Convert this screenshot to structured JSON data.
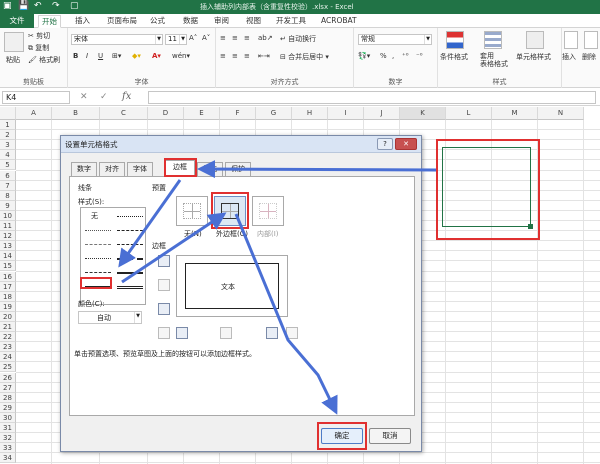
{
  "window": {
    "title": "插入辅助列内部表（含重复性校验）.xlsx - Excel"
  },
  "tabs": [
    "文件",
    "开始",
    "插入",
    "页面布局",
    "公式",
    "数据",
    "审阅",
    "视图",
    "开发工具",
    "ACROBAT"
  ],
  "ribbon": {
    "clipboard": {
      "paste": "粘贴",
      "cut": "剪切",
      "copy": "复制",
      "format_painter": "格式刷",
      "label": "剪贴板"
    },
    "font": {
      "name": "宋体",
      "size": "11",
      "bold": "B",
      "italic": "I",
      "underline": "U",
      "label": "字体",
      "font_color_glyph": "A",
      "wen": "wén"
    },
    "alignment": {
      "wrap": "自动换行",
      "merge": "合并后居中",
      "label": "对齐方式"
    },
    "number": {
      "format": "常规",
      "percent": "%",
      "comma": ",",
      "label": "数字"
    },
    "styles": {
      "conditional": "条件格式",
      "table": "套用\n表格格式",
      "cell_style": "单元格样式",
      "label": "样式"
    },
    "cells": {
      "insert": "插入",
      "delete": "删除"
    }
  },
  "formula_bar": {
    "name_box": "K4",
    "cancel": "✕",
    "enter": "✓",
    "fx": "fx",
    "content": ""
  },
  "grid": {
    "columns": [
      "A",
      "B",
      "C",
      "D",
      "E",
      "F",
      "G",
      "H",
      "I",
      "J",
      "K",
      "L",
      "M",
      "N"
    ],
    "rows": [
      "1",
      "2",
      "3",
      "4",
      "5",
      "6",
      "7",
      "8",
      "9",
      "10",
      "11",
      "12",
      "13",
      "14",
      "15",
      "16",
      "17",
      "18",
      "19",
      "20",
      "21",
      "22",
      "23",
      "24",
      "25",
      "26",
      "27",
      "28",
      "29",
      "30",
      "31",
      "32",
      "33",
      "34"
    ]
  },
  "dialog": {
    "title": "设置单元格格式",
    "help": "?",
    "close": "✕",
    "tabs": [
      "数字",
      "对齐",
      "字体",
      "边框",
      "填充",
      "保护"
    ],
    "selected_tab": "边框",
    "line_section": "线条",
    "style_label": "样式(S):",
    "style_none": "无",
    "color_label": "颜色(C):",
    "color_value": "自动",
    "preset_label": "预置",
    "presets": [
      "无(N)",
      "外边框(O)",
      "内部(I)"
    ],
    "border_label": "边框",
    "preview_text": "文本",
    "hint": "单击预置选项、预览草图及上面的按钮可以添加边框样式。",
    "ok": "确定",
    "cancel": "取消"
  },
  "colors": {
    "accent": "#217346",
    "highlight": "#e03030",
    "arrow": "#4a6fd4"
  }
}
